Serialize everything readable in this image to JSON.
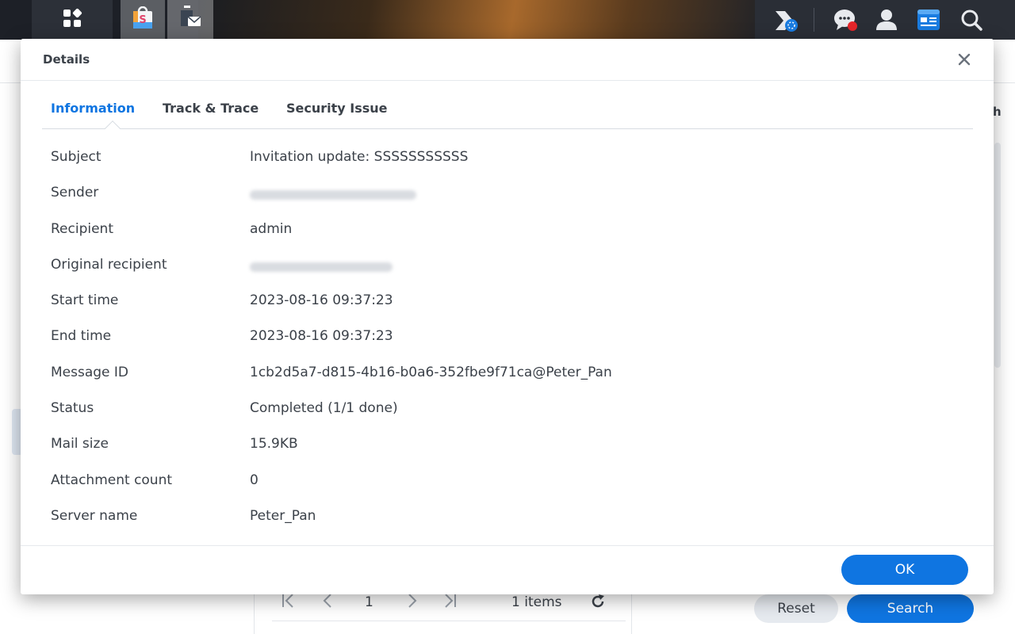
{
  "taskbar": {
    "icons": [
      "main-menu-icon",
      "package-center-icon",
      "mail-app-icon",
      "widget-icon",
      "chat-icon",
      "user-icon",
      "dashboard-icon",
      "search-icon"
    ],
    "colors": {
      "bar": "#1d2027",
      "accent": "#0f75e1",
      "notification": "#e4262a"
    }
  },
  "background_window": {
    "pager": {
      "page": "1",
      "items_label": "1 items"
    },
    "reset_label": "Reset",
    "search_label": "Search",
    "partial_text": "h"
  },
  "dialog": {
    "title": "Details",
    "tabs": [
      {
        "label": "Information",
        "active": true
      },
      {
        "label": "Track & Trace",
        "active": false
      },
      {
        "label": "Security Issue",
        "active": false
      }
    ],
    "fields": [
      {
        "label": "Subject",
        "value": "Invitation update: SSSSSSSSSSS"
      },
      {
        "label": "Sender",
        "value": ""
      },
      {
        "label": "Recipient",
        "value": "admin"
      },
      {
        "label": "Original recipient",
        "value": ""
      },
      {
        "label": "Start time",
        "value": "2023-08-16 09:37:23"
      },
      {
        "label": "End time",
        "value": "2023-08-16 09:37:23"
      },
      {
        "label": "Message ID",
        "value": "1cb2d5a7-d815-4b16-b0a6-352fbe9f71ca@Peter_Pan"
      },
      {
        "label": "Status",
        "value": "Completed (1/1 done)"
      },
      {
        "label": "Mail size",
        "value": "15.9KB"
      },
      {
        "label": "Attachment count",
        "value": "0"
      },
      {
        "label": "Server name",
        "value": "Peter_Pan"
      }
    ],
    "ok_label": "OK"
  }
}
